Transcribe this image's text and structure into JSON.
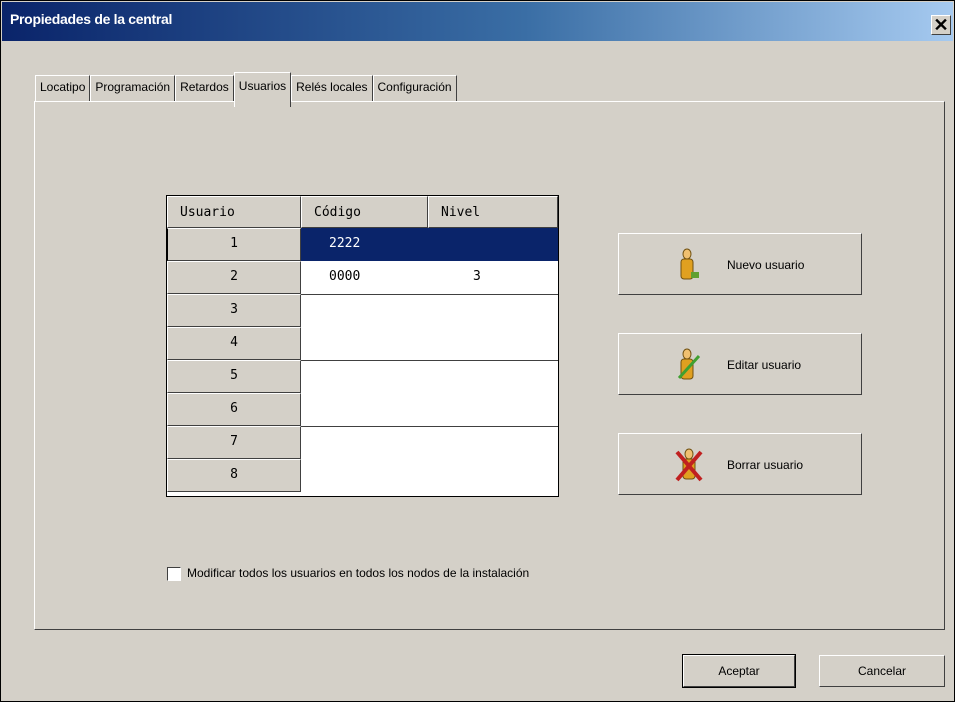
{
  "window": {
    "title": "Propiedades de la central",
    "close_glyph": "✕"
  },
  "tabs": [
    {
      "label": "Locatipo"
    },
    {
      "label": "Programación"
    },
    {
      "label": "Retardos"
    },
    {
      "label": "Usuarios",
      "active": true
    },
    {
      "label": "Relés locales"
    },
    {
      "label": "Configuración"
    }
  ],
  "grid": {
    "headers": [
      "Usuario",
      "Código",
      "Nivel"
    ],
    "rows": [
      {
        "usuario": "1",
        "codigo": "2222",
        "nivel": "",
        "selected": true
      },
      {
        "usuario": "2",
        "codigo": "0000",
        "nivel": "3"
      },
      {
        "usuario": "3",
        "codigo": "",
        "nivel": ""
      },
      {
        "usuario": "4",
        "codigo": "",
        "nivel": ""
      },
      {
        "usuario": "5",
        "codigo": "",
        "nivel": ""
      },
      {
        "usuario": "6",
        "codigo": "",
        "nivel": ""
      },
      {
        "usuario": "7",
        "codigo": "",
        "nivel": ""
      },
      {
        "usuario": "8",
        "codigo": "",
        "nivel": ""
      }
    ]
  },
  "actions": {
    "nuevo": {
      "label": "Nuevo usuario",
      "icon": "user-add-icon"
    },
    "editar": {
      "label": "Editar usuario",
      "icon": "user-edit-icon"
    },
    "borrar": {
      "label": "Borrar usuario",
      "icon": "user-delete-icon"
    }
  },
  "checkbox": {
    "label": "Modificar todos los usuarios en todos los nodos de la instalación",
    "checked": false
  },
  "footer": {
    "accept": "Aceptar",
    "cancel": "Cancelar"
  }
}
